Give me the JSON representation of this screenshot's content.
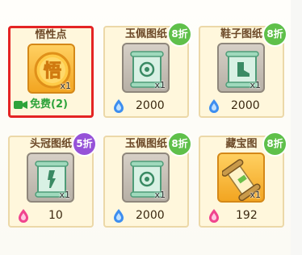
{
  "cards": [
    {
      "title": "悟性点",
      "count": "x1",
      "free_label": "免费(2)",
      "icon_glyph": "悟",
      "icon": "wuxing-coin-icon"
    },
    {
      "title": "玉佩图纸",
      "count": "x1",
      "price": "2000",
      "discount": "8折",
      "currency": "blue-gem-icon",
      "icon": "jade-pendant-scroll-icon"
    },
    {
      "title": "鞋子图纸",
      "count": "x1",
      "price": "2000",
      "discount": "8折",
      "currency": "blue-gem-icon",
      "icon": "shoes-scroll-icon"
    },
    {
      "title": "头冠图纸",
      "count": "x1",
      "price": "10",
      "discount": "5折",
      "currency": "pink-gem-icon",
      "icon": "crown-scroll-icon"
    },
    {
      "title": "玉佩图纸",
      "count": "x1",
      "price": "2000",
      "discount": "8折",
      "currency": "blue-gem-icon",
      "icon": "jade-pendant-scroll-icon"
    },
    {
      "title": "藏宝图",
      "count": "x1",
      "price": "192",
      "discount": "8折",
      "currency": "pink-gem-icon",
      "icon": "treasure-map-icon"
    }
  ],
  "colors": {
    "selected_border": "#e42424",
    "badge_green": "#5fc04a",
    "badge_purple": "#9652d8",
    "free_text": "#2ea33b"
  }
}
